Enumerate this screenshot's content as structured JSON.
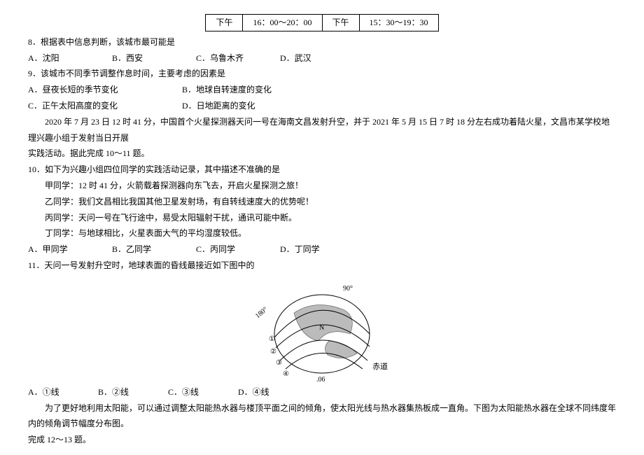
{
  "table": {
    "r1c1": "下午",
    "r1c2": "16：00～20：00",
    "r1c3": "下午",
    "r1c4": "15：30～19：30"
  },
  "q8": {
    "stem": "8．根据表中信息判断，该城市最可能是",
    "A": "A．沈阳",
    "B": "B．西安",
    "C": "C．乌鲁木齐",
    "D": "D．武汉"
  },
  "q9": {
    "stem": "9．该城市不同季节调整作息时间，主要考虑的因素是",
    "A": "A．昼夜长短的季节变化",
    "B": "B．地球自转速度的变化",
    "C": "C．正午太阳高度的变化",
    "D": "D．日地距离的变化"
  },
  "passage1": {
    "p1": "2020 年 7 月 23 日 12 时 41 分，中国首个火星探测器天问一号在海南文昌发射升空，并于 2021 年 5 月 15 日 7 时 18 分左右成功着陆火星，文昌市某学校地理兴趣小组于发射当日开展",
    "p2": "实践活动。据此完成 10～11 题。"
  },
  "q10": {
    "stem": "10．如下为兴趣小组四位同学的实践活动记录，其中描述不准确的是",
    "l1": "甲同学：12 时 41 分，火箭载着探测器向东飞去，开启火星探测之旅！",
    "l2": "乙同学：我们文昌相比我国其他卫星发射场，有自转线速度大的优势呢！",
    "l3": "丙同学：天问一号在飞行途中，易受太阳辐射干扰，通讯可能中断。",
    "l4": "丁同学：与地球相比，火星表面大气的平均湿度较低。",
    "A": "A．甲同学",
    "B": "B．乙同学",
    "C": "C．丙同学",
    "D": "D．丁同学"
  },
  "q11": {
    "stem": "11．天问一号发射升空时，地球表面的昏线最接近如下图中的",
    "A": "A．①线",
    "B": "B．②线",
    "C": "C．③线",
    "D": "D．④线"
  },
  "figure": {
    "alt": "earth-terminator-diagram",
    "l90": "90°",
    "l180": "180°",
    "lN": "N",
    "l06": ".06",
    "equator": "赤道",
    "c1": "①",
    "c2": "②",
    "c3": "③",
    "c4": "④"
  },
  "passage2": {
    "p1": "为了更好地利用太阳能，可以通过调整太阳能热水器与楼顶平面之间的倾角，使太阳光线与热水器集热板成一直角。下图为太阳能热水器在全球不同纬度年内的倾角调节幅度分布图。",
    "p2": "完成 12～13 题。"
  }
}
